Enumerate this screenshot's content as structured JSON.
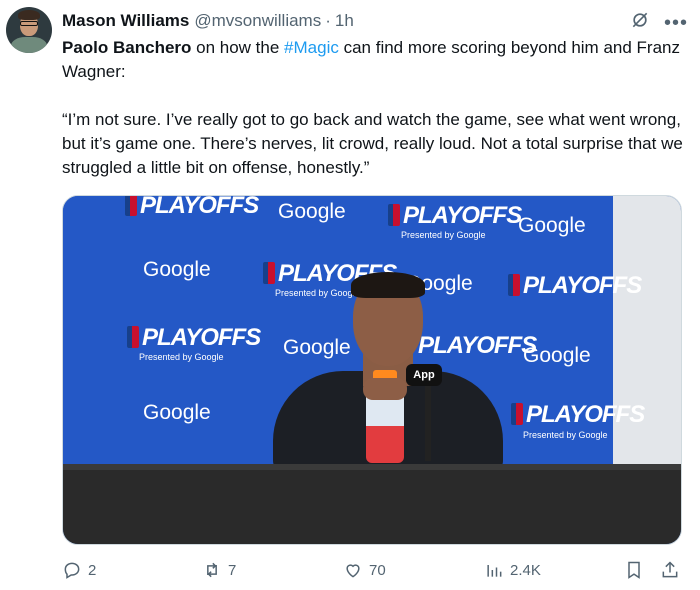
{
  "author": {
    "name": "Mason Williams",
    "handle": "@mvsonwilliams",
    "separator": "·",
    "time": "1h"
  },
  "tweet": {
    "line1_bold": "Paolo Banchero",
    "line1_pre": " on how the ",
    "hashtag": "#Magic",
    "line1_post": " can find more scoring beyond him and Franz Wagner:",
    "quote": "“I’m not sure. I’ve really got to go back and watch the game, see what went wrong, but it’s game one. There’s nerves, lit crowd, really loud. Not a total surprise that we struggled a little bit on offense, honestly.”"
  },
  "media": {
    "sponsor_text": "Google",
    "playoffs_text": "PLAYOFFS",
    "presented_text": "Presented by Google",
    "mic_label": "App"
  },
  "actions": {
    "replies": "2",
    "reposts": "7",
    "likes": "70",
    "views": "2.4K"
  },
  "icons": [
    "grok-icon",
    "more-icon",
    "reply-icon",
    "repost-icon",
    "like-icon",
    "views-icon",
    "bookmark-icon",
    "share-icon"
  ],
  "colors": {
    "link": "#1d9bf0",
    "muted": "#536471",
    "text": "#0f1419"
  }
}
